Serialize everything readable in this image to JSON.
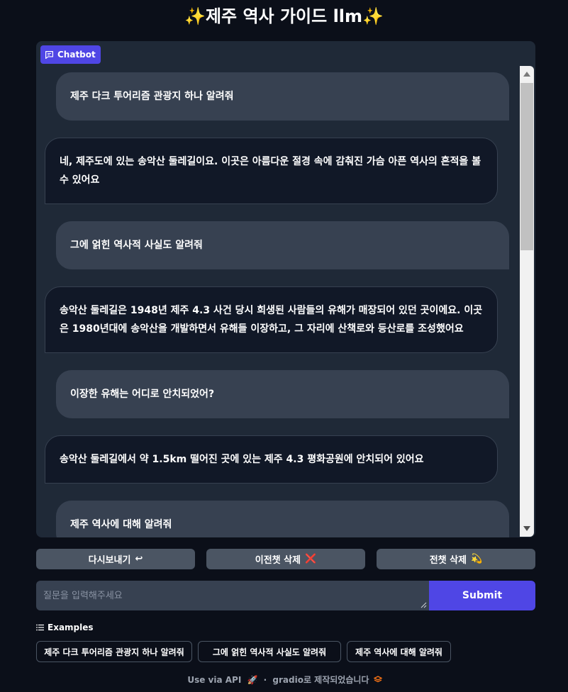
{
  "header": {
    "title": "✨제주 역사 가이드 llm✨"
  },
  "chatbot": {
    "label": "Chatbot",
    "icon": "chat-bubble-icon",
    "messages": [
      {
        "role": "user",
        "text": "제주 다크 투어리즘 관광지 하나 알려줘"
      },
      {
        "role": "bot",
        "text": "네, 제주도에 있는 송악산 둘레길이요. 이곳은 아름다운 절경 속에 감춰진 가슴 아픈 역사의 흔적을 볼 수 있어요"
      },
      {
        "role": "user",
        "text": "그에 얽힌 역사적 사실도 알려줘"
      },
      {
        "role": "bot",
        "text": "송악산 둘레길은 1948년 제주 4.3 사건 당시 희생된 사람들의 유해가 매장되어 있던 곳이에요. 이곳은 1980년대에 송악산을 개발하면서 유해들 이장하고, 그 자리에 산책로와 등산로를 조성했어요"
      },
      {
        "role": "user",
        "text": "이장한 유해는 어디로 안치되었어?"
      },
      {
        "role": "bot",
        "text": "송악산 둘레길에서 약 1.5km 떨어진 곳에 있는 제주 4.3 평화공원에 안치되어 있어요"
      },
      {
        "role": "user",
        "text": "제주 역사에 대해 알려줘"
      }
    ]
  },
  "buttons": {
    "retry": {
      "label": "다시보내기",
      "icon": "↩"
    },
    "undo": {
      "label": "이전챗 삭제",
      "icon": "❌"
    },
    "clear": {
      "label": "전챗 삭제",
      "icon": "💫"
    }
  },
  "input": {
    "placeholder": "질문을 입력해주세요",
    "value": ""
  },
  "submit": {
    "label": "Submit"
  },
  "examples": {
    "heading": "Examples",
    "items": [
      "제주 다크 투어리즘 관광지 하나 알려줘",
      "그에 얽힌 역사적 사실도 알려줘",
      "제주 역사에 대해 알려줘"
    ]
  },
  "footer": {
    "api_link": "Use via API",
    "api_icon": "🚀",
    "separator": "·",
    "built_with": "gradio로 제작되었습니다",
    "gradio_icon": "gradio-logo-icon"
  },
  "colors": {
    "background": "#0b0f19",
    "panel": "#1f2937",
    "user_bubble": "#374151",
    "bot_bubble": "#111827",
    "accent": "#4f46e5",
    "button": "#4b5563"
  }
}
